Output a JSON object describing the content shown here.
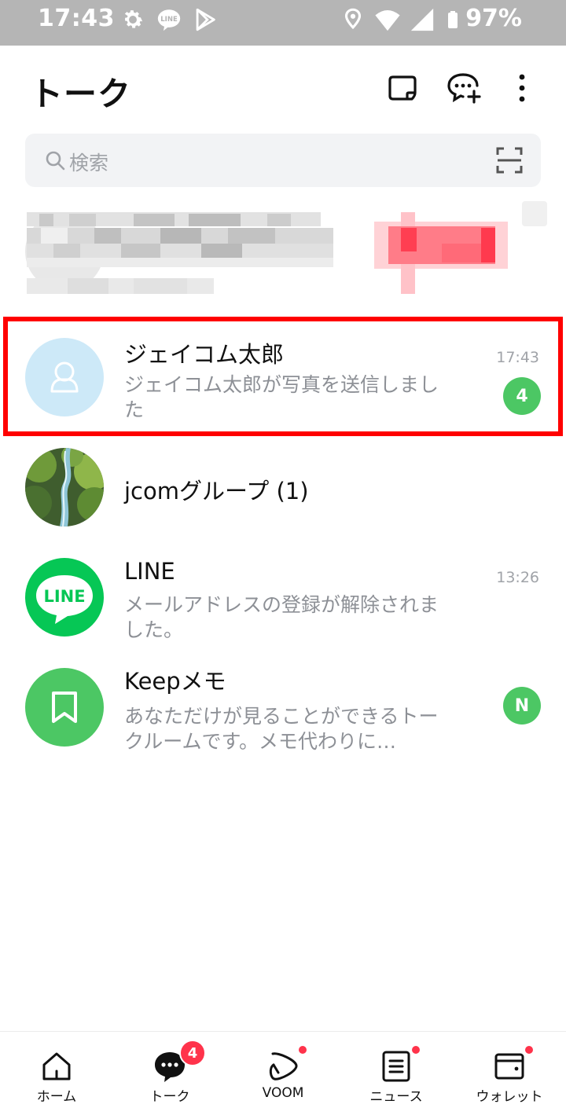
{
  "status_bar": {
    "time": "17:43",
    "battery_percent": "97%",
    "left_icons": [
      "gear-icon",
      "line-app-icon",
      "play-store-icon"
    ],
    "right_icons": [
      "location-pin-icon",
      "wifi-icon",
      "signal-icon",
      "battery-icon"
    ],
    "background": "#b5b5b5"
  },
  "header": {
    "title": "トーク",
    "buttons": [
      "note-icon",
      "new-chat-icon",
      "more-vertical-icon"
    ]
  },
  "search": {
    "placeholder": "検索"
  },
  "chats": [
    {
      "name": "ジェイコム太郎",
      "preview": "ジェイコム太郎が写真を送信しました",
      "time": "17:43",
      "badge": "4",
      "avatar": "default-person-icon",
      "highlighted": true
    },
    {
      "name": "jcomグループ (1)",
      "preview": "",
      "time": "",
      "badge": "",
      "avatar": "waterfall-photo"
    },
    {
      "name": "LINE",
      "preview": "メールアドレスの登録が解除されました。",
      "time": "13:26",
      "badge": "",
      "avatar": "line-logo",
      "avatar_text": "LINE"
    },
    {
      "name": "Keepメモ",
      "preview": "あなただけが見ることができるトークルームです。メモ代わりに…",
      "time": "",
      "badge": "N",
      "avatar": "bookmark-icon"
    }
  ],
  "bottom_nav": [
    {
      "label": "ホーム",
      "icon": "home-icon",
      "dot": false,
      "badge": ""
    },
    {
      "label": "トーク",
      "icon": "chat-bubble-icon",
      "dot": false,
      "badge": "4",
      "active": true
    },
    {
      "label": "VOOM",
      "icon": "voom-icon",
      "dot": true,
      "badge": ""
    },
    {
      "label": "ニュース",
      "icon": "news-icon",
      "dot": true,
      "badge": ""
    },
    {
      "label": "ウォレット",
      "icon": "wallet-icon",
      "dot": true,
      "badge": ""
    }
  ],
  "colors": {
    "accent_green": "#4cc764",
    "line_green": "#06c755",
    "badge_red": "#ff334b",
    "highlight_red": "#ff0000",
    "default_avatar_bg": "#cde9f8"
  }
}
